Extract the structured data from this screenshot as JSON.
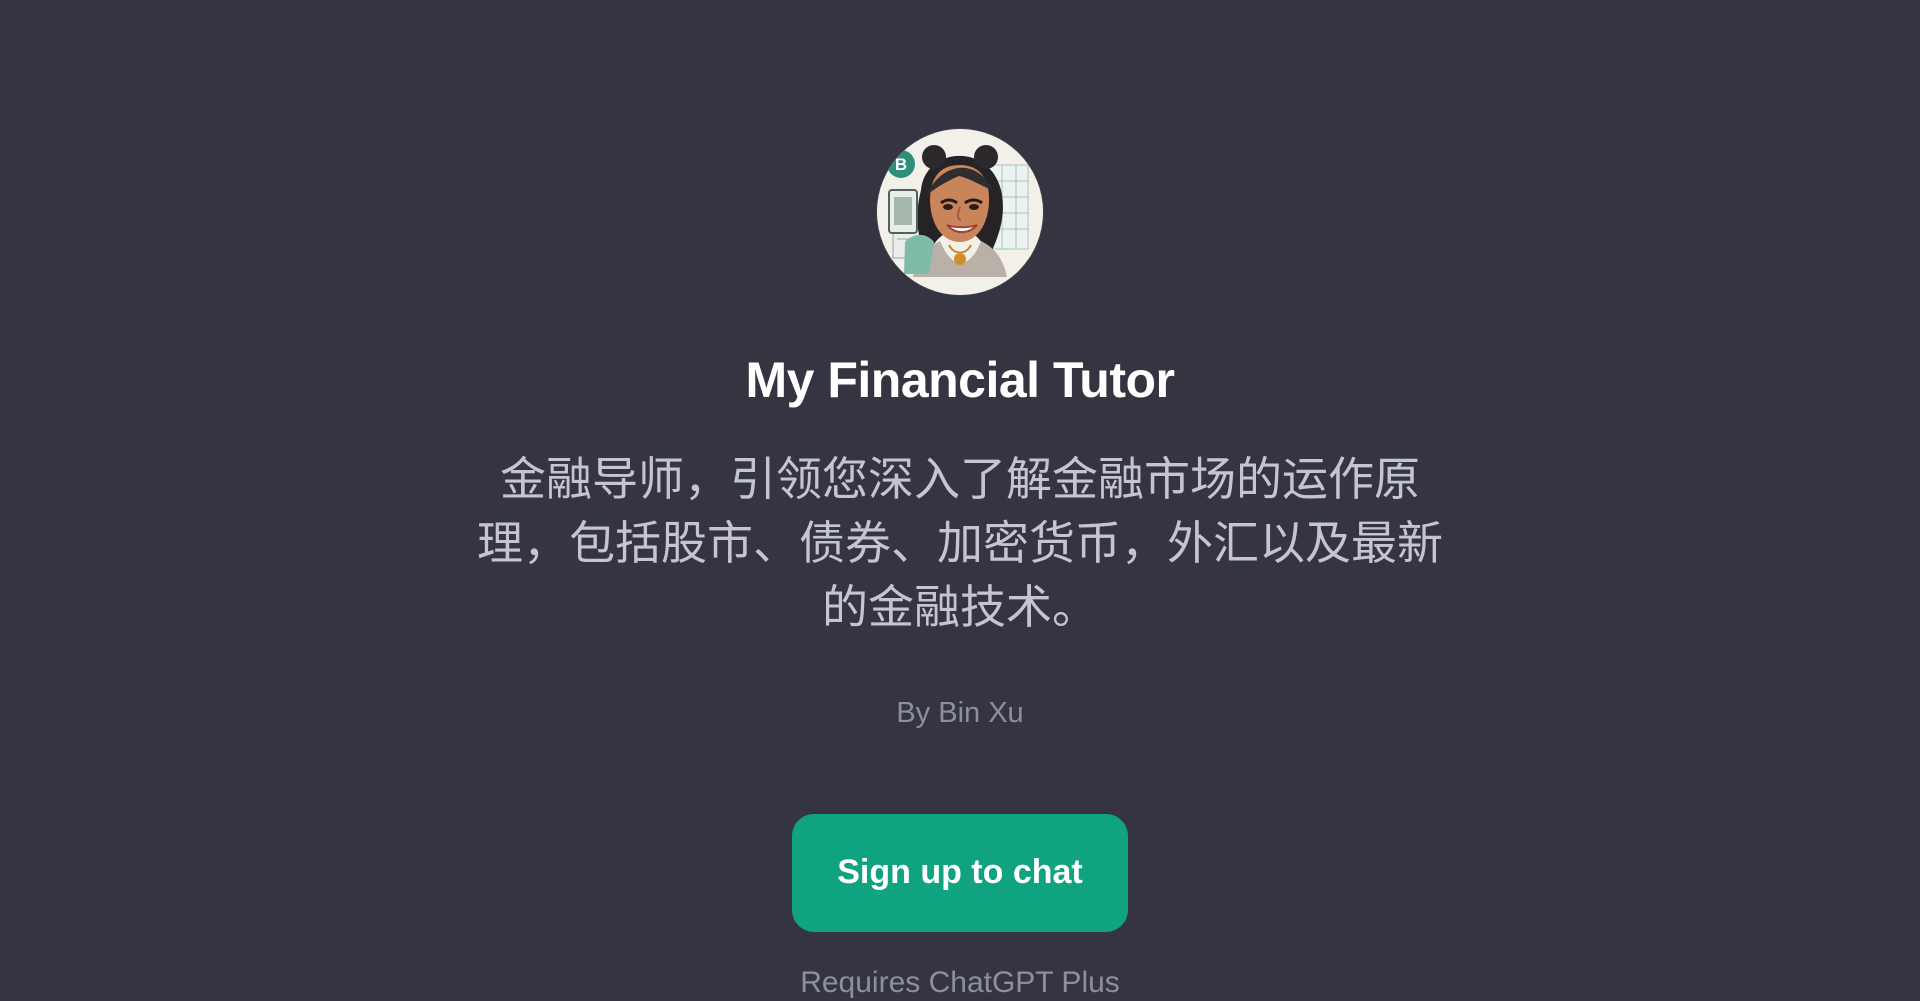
{
  "app": {
    "title": "My Financial Tutor",
    "description": "金融导师，引领您深入了解金融市场的运作原理，包括股市、债券、加密货币，外汇以及最新的金融技术。",
    "author": "By Bin Xu",
    "cta_label": "Sign up to chat",
    "requirement": "Requires ChatGPT Plus"
  },
  "avatar": {
    "icon": "financial-tutor-avatar",
    "coin_symbol": "B"
  },
  "colors": {
    "background": "#343541",
    "title": "#ffffff",
    "description": "#c5c5d2",
    "muted": "#8e8ea0",
    "accent": "#10a37f"
  }
}
